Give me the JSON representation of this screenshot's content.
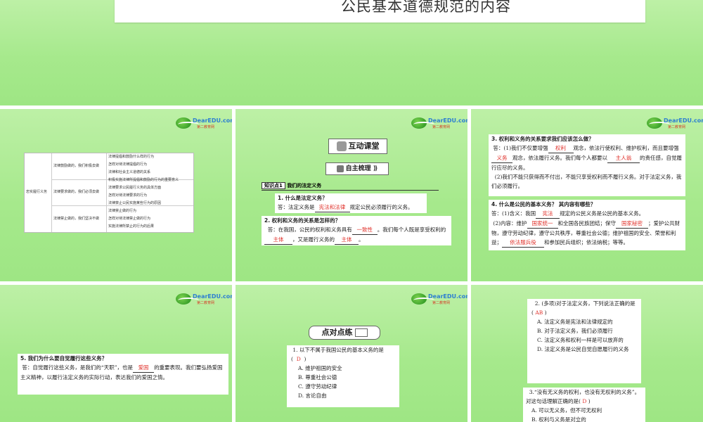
{
  "title_slide": {
    "title": "公民基本道德规范的内容"
  },
  "logo": {
    "brand": "DearEDU.com",
    "sub": "第二教育网"
  },
  "slide1": {
    "root": "忠实履行义务",
    "groups": [
      "法律鼓励做的，我们积极去做",
      "法律要求做的，我们必须去做",
      "法律禁止做的，我们坚决不做"
    ],
    "items": [
      "法律提倡和鼓励什么样的行为",
      "怎样对待法律提倡的行为",
      "法律和社会主义道德的关系",
      "积极实施法律所提倡和鼓励的行为的重要意义",
      "法律要求公民履行义务的具体方面",
      "怎样对待法律要求的行为",
      "法律禁止公民实施某些行为的原因",
      "法律禁止做的行为",
      "怎样对待法律禁止做的行为",
      "实施法律所禁止的行为的后果"
    ]
  },
  "slide2": {
    "banner": "互动课堂",
    "sub_banner": "自主梳理",
    "point": "知识点1",
    "point_title": "我们的法定义务",
    "q1": "1. 什么是法定义务？",
    "a1_pre": "答：法定义务是",
    "a1_ans": "宪法和法律",
    "a1_post": "规定公民必须履行的义务。",
    "q2": "2. 权利和义务的关系是怎样的？",
    "a2_pre": "答：在我国，公民的权利和义务具有",
    "a2_ans1": "一致性",
    "a2_mid": "。我们每个人既是享受权利的",
    "a2_ans2": "主体",
    "a2_mid2": "，又是履行义务的",
    "a2_ans3": "主体",
    "a2_end": "。"
  },
  "slide3": {
    "q3": "3. 权利和义务的关系要求我们应该怎么做？",
    "a3_1": "答：(1)我们不仅要增强",
    "a3_ans1": "权利",
    "a3_2": "观念，依法行使权利、维护权利，而且要增强",
    "a3_ans2": "义务",
    "a3_3": "观念，依法履行义务。我们每个人都要以",
    "a3_ans3": "主人翁",
    "a3_4": "的责任感，自觉履行应尽的义务。",
    "a3_5": "(2)我们不能只获得而不付出，不能只享受权利而不履行义务。对于法定义务，我们必须履行。",
    "q4": "4. 什么是公民的基本义务？ 其内容有哪些？",
    "a4_1": "答：(1)含义：我国",
    "a4_ans1": "宪法",
    "a4_2": "规定的公民义务是公民的基本义务。",
    "a4_3": "(2)内容：维护",
    "a4_ans2": "国家统一",
    "a4_4": "和全国各民族团结；保守",
    "a4_ans3": "国家秘密",
    "a4_5": "；爱护公共财物，遵守劳动纪律，遵守公共秩序，尊重社会公德；维护祖国的安全、荣誉和利益；",
    "a4_ans4": "依法服兵役",
    "a4_6": "和参加民兵组织；依法纳税；等等。"
  },
  "slide4": {
    "q5": "5. 我们为什么要自觉履行这些义务？",
    "a5_1": "答：自觉履行这些义务，是我们的“天职”，也是",
    "a5_ans": "爱国",
    "a5_2": "的重要表现。我们要弘扬爱国主义精神，以履行法定义务的实际行动，表达我们的爱国之情。"
  },
  "slide5": {
    "banner": "点对点练",
    "q1": "1. 以下不属于我国公民的基本义务的是(",
    "q1_ans": "D",
    "q1_end": ")",
    "options": [
      "A. 维护祖国的安全",
      "B. 尊重社会公德",
      "C. 遵守劳动纪律",
      "D. 言论自由"
    ]
  },
  "slide6": {
    "q2": "2. (多项)对于法定义务，下列说法正确的是(",
    "q2_ans": "AB",
    "q2_end": ")",
    "options": [
      "A. 法定义务是宪法和法律规定的",
      "B. 对于法定义务，我们必须履行",
      "C. 法定义务和权利一样是可以放弃的",
      "D. 法定义务是公民自觉自愿履行的义务"
    ],
    "q3": "3.“没有无义务的权利，也没有无权利的义务”。对这句话理解正确的是(",
    "q3_ans": "D",
    "q3_end": ")",
    "q3_opts": [
      "A. 可以无义务，但不可无权利",
      "B. 权利与义务是对立的"
    ]
  }
}
